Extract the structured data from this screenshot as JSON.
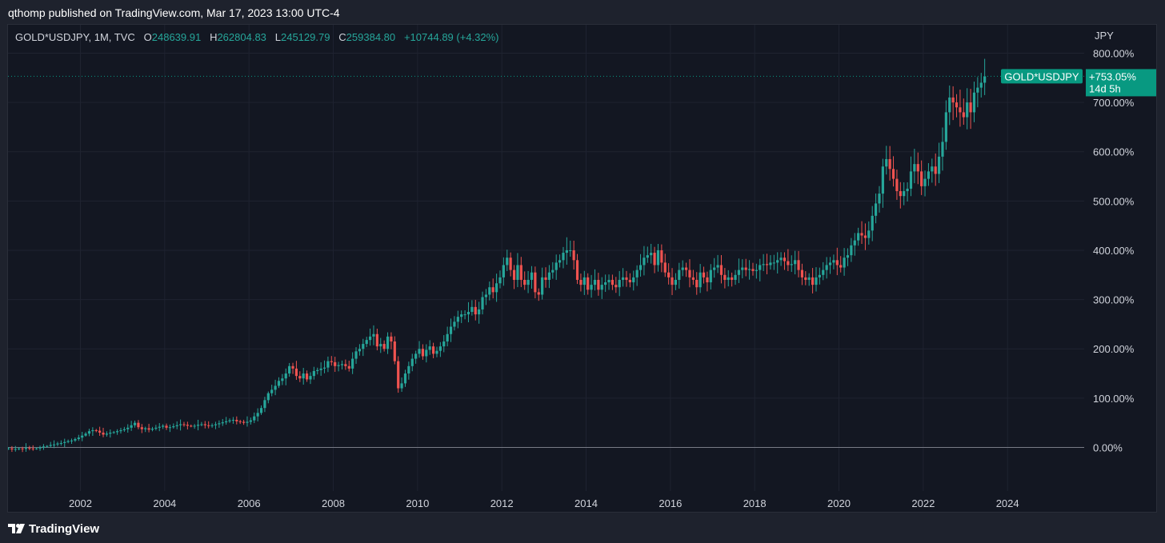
{
  "header": {
    "publisher_line": "qthomp published on TradingView.com, Mar 17, 2023 13:00 UTC-4"
  },
  "legend": {
    "symbol": "GOLD*USDJPY, 1M, TVC",
    "o_label": "O",
    "o_value": "248639.91",
    "h_label": "H",
    "h_value": "262804.83",
    "l_label": "L",
    "l_value": "245129.79",
    "c_label": "C",
    "c_value": "259384.80",
    "change": "+10744.89 (+4.32%)"
  },
  "price_tag": {
    "symbol": "GOLD*USDJPY",
    "value": "+753.05%",
    "countdown": "14d 5h"
  },
  "footer": {
    "brand": "TradingView"
  },
  "colors": {
    "up": "#26a69a",
    "down": "#ef5350",
    "background": "#131722",
    "grid": "#1f2330",
    "text": "#d1d4dc",
    "tag": "#089981"
  },
  "chart_data": {
    "type": "candlestick",
    "series_name": "GOLD*USDJPY",
    "interval": "1M",
    "y_unit": "JPY",
    "y_scale": "percent",
    "ylim": [
      -80,
      800
    ],
    "xlim": [
      2000.0,
      2025.5
    ],
    "y_ticks": [
      {
        "value": 800,
        "label": "800.00%"
      },
      {
        "value": 700,
        "label": "700.00%"
      },
      {
        "value": 600,
        "label": "600.00%"
      },
      {
        "value": 500,
        "label": "500.00%"
      },
      {
        "value": 400,
        "label": "400.00%"
      },
      {
        "value": 300,
        "label": "300.00%"
      },
      {
        "value": 200,
        "label": "200.00%"
      },
      {
        "value": 100,
        "label": "100.00%"
      },
      {
        "value": 0,
        "label": "0.00%"
      }
    ],
    "x_ticks": [
      {
        "value": 2002,
        "label": "2002"
      },
      {
        "value": 2004,
        "label": "2004"
      },
      {
        "value": 2006,
        "label": "2006"
      },
      {
        "value": 2008,
        "label": "2008"
      },
      {
        "value": 2010,
        "label": "2010"
      },
      {
        "value": 2012,
        "label": "2012"
      },
      {
        "value": 2014,
        "label": "2014"
      },
      {
        "value": 2016,
        "label": "2016"
      },
      {
        "value": 2018,
        "label": "2018"
      },
      {
        "value": 2020,
        "label": "2020"
      },
      {
        "value": 2022,
        "label": "2022"
      },
      {
        "value": 2024,
        "label": "2024"
      }
    ],
    "start": "2000-01",
    "close_pct": [
      0,
      -2,
      -3,
      -2,
      -4,
      -3,
      -2,
      -3,
      -1,
      -2,
      -3,
      -2,
      0,
      2,
      3,
      5,
      6,
      8,
      9,
      11,
      13,
      14,
      17,
      20,
      24,
      28,
      33,
      35,
      34,
      30,
      26,
      28,
      30,
      31,
      33,
      35,
      37,
      40,
      45,
      50,
      41,
      37,
      39,
      36,
      38,
      40,
      42,
      44,
      40,
      41,
      43,
      45,
      47,
      46,
      44,
      43,
      44,
      46,
      47,
      45,
      44,
      45,
      47,
      49,
      51,
      53,
      55,
      56,
      53,
      52,
      50,
      52,
      55,
      63,
      70,
      80,
      96,
      110,
      117,
      125,
      135,
      140,
      150,
      165,
      160,
      145,
      140,
      150,
      138,
      145,
      155,
      157,
      160,
      162,
      175,
      173,
      165,
      167,
      169,
      165,
      160,
      180,
      195,
      200,
      210,
      218,
      225,
      230,
      205,
      210,
      200,
      225,
      215,
      175,
      120,
      130,
      150,
      165,
      180,
      190,
      200,
      185,
      198,
      205,
      190,
      196,
      205,
      215,
      230,
      245,
      255,
      265,
      270,
      270,
      275,
      285,
      270,
      280,
      305,
      310,
      325,
      315,
      333,
      345,
      370,
      385,
      360,
      340,
      370,
      340,
      330,
      340,
      355,
      315,
      310,
      345,
      340,
      355,
      360,
      375,
      380,
      395,
      400,
      400,
      380,
      340,
      330,
      345,
      320,
      330,
      340,
      320,
      330,
      335,
      340,
      330,
      325,
      340,
      345,
      340,
      335,
      345,
      360,
      370,
      385,
      390,
      395,
      370,
      400,
      375,
      355,
      345,
      330,
      340,
      360,
      365,
      360,
      345,
      340,
      325,
      355,
      345,
      335,
      360,
      365,
      370,
      350,
      340,
      345,
      340,
      350,
      360,
      365,
      360,
      362,
      358,
      360,
      370,
      372,
      370,
      375,
      375,
      380,
      385,
      378,
      370,
      372,
      380,
      360,
      345,
      340,
      345,
      330,
      345,
      350,
      360,
      370,
      375,
      380,
      370,
      365,
      385,
      390,
      410,
      420,
      435,
      430,
      425,
      440,
      470,
      495,
      515,
      570,
      585,
      565,
      545,
      520,
      510,
      520,
      525,
      560,
      575,
      560,
      530,
      545,
      560,
      570,
      555,
      590,
      620,
      680,
      710,
      700,
      690,
      680,
      670,
      700,
      680,
      720,
      730,
      740,
      753
    ]
  }
}
